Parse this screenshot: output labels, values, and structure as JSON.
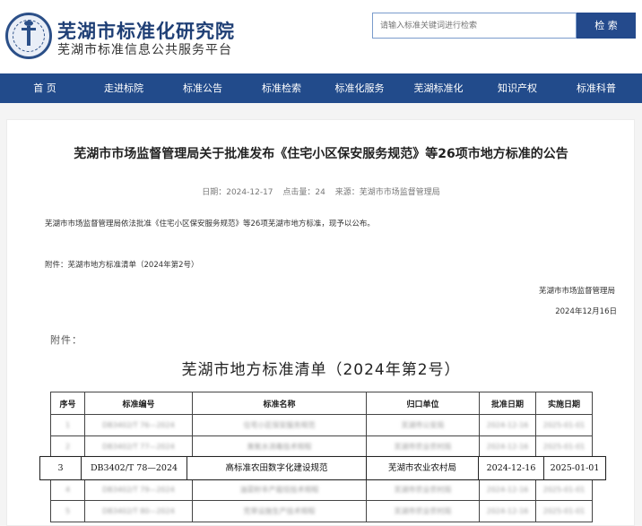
{
  "header": {
    "site_title": "芜湖市标准化研究院",
    "site_subtitle": "芜湖市标准信息公共服务平台",
    "search_placeholder": "请输入标准关键词进行检索",
    "search_button": "检 索"
  },
  "nav": {
    "items": [
      {
        "label": "首 页"
      },
      {
        "label": "走进标院"
      },
      {
        "label": "标准公告"
      },
      {
        "label": "标准检索"
      },
      {
        "label": "标准化服务"
      },
      {
        "label": "芜湖标准化"
      },
      {
        "label": "知识产权"
      },
      {
        "label": "标准科普"
      }
    ]
  },
  "article": {
    "title": "芜湖市市场监督管理局关于批准发布《住宅小区保安服务规范》等26项市地方标准的公告",
    "meta_date": "日期：2024-12-17",
    "meta_hits": "点击量：24",
    "meta_source": "来源：芜湖市市场监督管理局",
    "paragraph": "芜湖市市场监督管理局依法批准《住宅小区保安服务规范》等26项芜湖市地方标准，现予以公布。",
    "attachment_line": "附件：芜湖市地方标准清单（2024年第2号）",
    "issuer": "芜湖市市场监督管理局",
    "issue_date": "2024年12月16日",
    "attach_label": "附件：",
    "list_title": "芜湖市地方标准清单（2024年第2号）"
  },
  "table": {
    "headers": [
      "序号",
      "标准编号",
      "标准名称",
      "归口单位",
      "批准日期",
      "实施日期"
    ],
    "rows": [
      [
        "1",
        "DB3402/T 76—2024",
        "住宅小区保安服务规范",
        "芜湖市公安局",
        "2024-12-16",
        "2025-01-01"
      ],
      [
        "2",
        "DB3402/T 77—2024",
        "臭氧水消毒技术规程",
        "芜湖市农业农村局",
        "2024-12-16",
        "2025-01-01"
      ],
      [
        "3",
        "DB3402/T 78—2024",
        "高标准农田数字化建设规范",
        "芜湖市农业农村局",
        "2024-12-16",
        "2025-01-01"
      ],
      [
        "4",
        "DB3402/T 79—2024",
        "油菜籽丰产栽培技术规程",
        "芜湖市农业农村局",
        "2024-12-16",
        "2025-01-01"
      ],
      [
        "5",
        "DB3402/T 80—2024",
        "荒草设施生产技术规程",
        "芜湖市农业农村局",
        "2024-12-16",
        "2025-01-01"
      ]
    ]
  }
}
